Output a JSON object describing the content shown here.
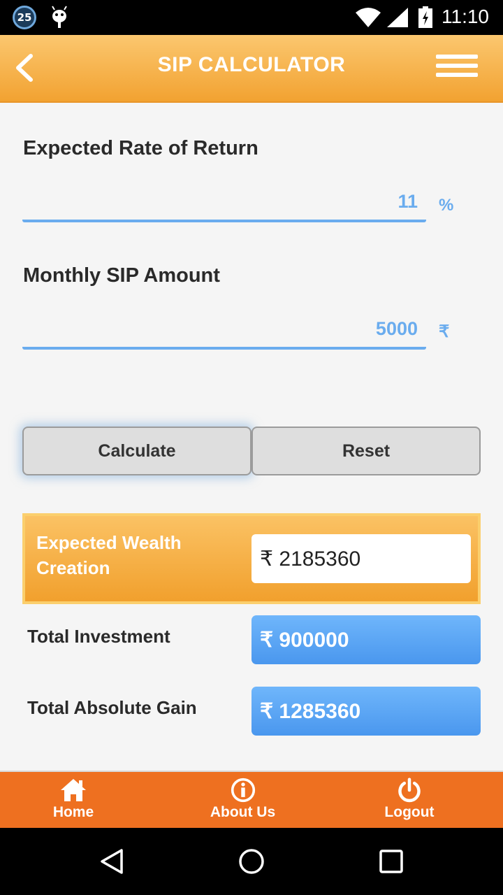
{
  "status_bar": {
    "notification_count": "25",
    "time": "11:10",
    "icons": [
      "notification-badge",
      "android-icon",
      "wifi-icon",
      "signal-icon",
      "battery-icon"
    ]
  },
  "app_bar": {
    "title": "SIP CALCULATOR",
    "back_icon": "chevron-left-icon",
    "menu_icon": "hamburger-menu-icon"
  },
  "form": {
    "rate_label": "Expected Rate of Return",
    "rate_value": "11",
    "rate_unit": "%",
    "amount_label": "Monthly SIP Amount",
    "amount_value": "5000",
    "amount_unit": "₹"
  },
  "buttons": {
    "calculate": "Calculate",
    "reset": "Reset"
  },
  "results": {
    "wealth_label": "Expected Wealth Creation",
    "wealth_value": "₹ 2185360",
    "investment_label": "Total Investment",
    "investment_value": "₹ 900000",
    "gain_label": "Total Absolute Gain",
    "gain_value": "₹ 1285360"
  },
  "bottom_nav": {
    "home": "Home",
    "about": "About Us",
    "logout": "Logout"
  },
  "colors": {
    "accent_orange": "#f2a231",
    "nav_orange": "#ee7020",
    "accent_blue": "#6aacee"
  }
}
